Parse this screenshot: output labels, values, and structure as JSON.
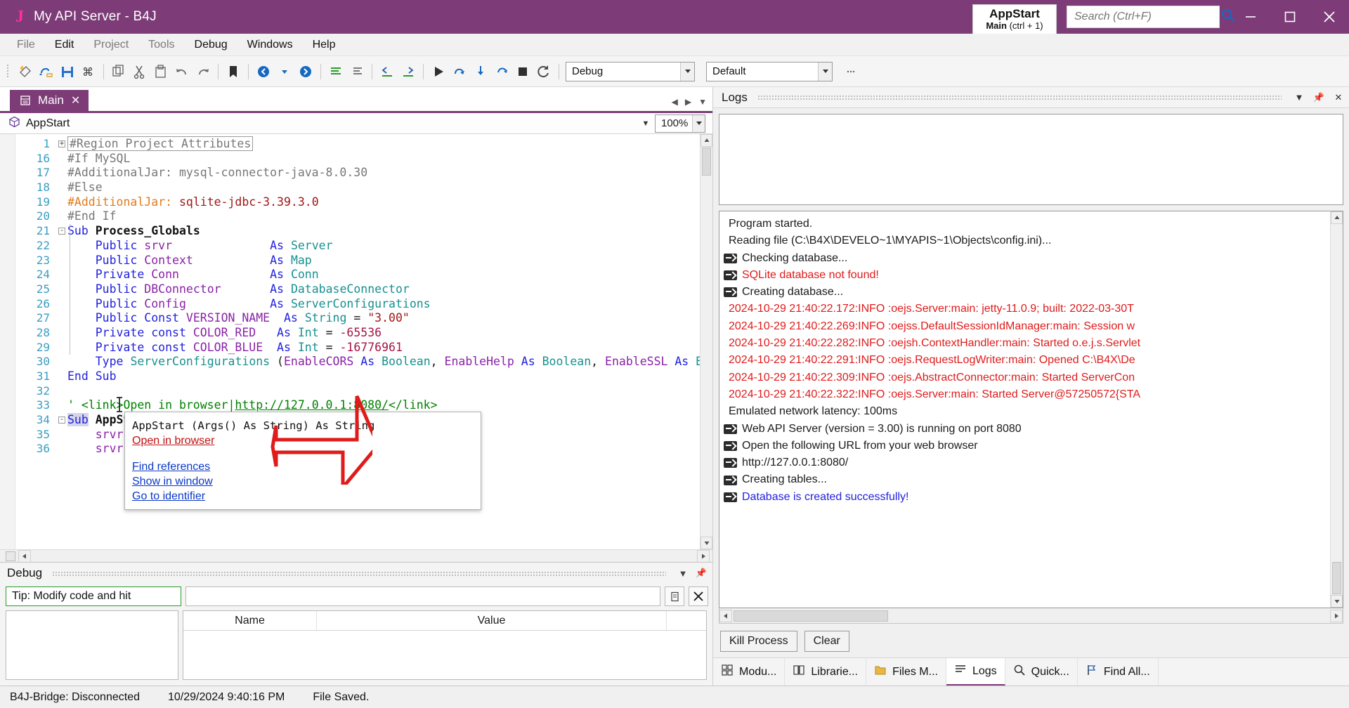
{
  "titlebar": {
    "logo": "J",
    "title": "My API Server - B4J",
    "appstart_chip": {
      "line1": "AppStart",
      "line2_bold": "Main",
      "line2_rest": "(ctrl + 1)"
    },
    "search_placeholder": "Search (Ctrl+F)",
    "window_buttons": [
      "minimize-button",
      "maximize-button",
      "close-button"
    ]
  },
  "menubar": {
    "items": [
      {
        "label": "File",
        "active": false
      },
      {
        "label": "Edit",
        "active": true
      },
      {
        "label": "Project",
        "active": false
      },
      {
        "label": "Tools",
        "active": false
      },
      {
        "label": "Debug",
        "active": true
      },
      {
        "label": "Windows",
        "active": true
      },
      {
        "label": "Help",
        "active": true
      }
    ]
  },
  "toolbar": {
    "configuration_value": "Debug",
    "build_value": "Default"
  },
  "editor": {
    "tab_label": "Main",
    "tab_close": "✕",
    "breadcrumb": "AppStart",
    "zoom_level": "100%",
    "lines": [
      {
        "num": "1",
        "fold": "+",
        "html": "<span class=\"regionbox\">#Region Project Attributes</span>"
      },
      {
        "num": "16",
        "fold": "",
        "html": "<span class=\"g\">#If MySQL</span>"
      },
      {
        "num": "17",
        "fold": "",
        "html": "<span class=\"g\">#AdditionalJar: mysql-connector-java-8.0.30</span>"
      },
      {
        "num": "18",
        "fold": "",
        "html": "<span class=\"g\">#Else</span>"
      },
      {
        "num": "19",
        "fold": "",
        "html": "<span class=\"o\">#AdditionalJar:</span> <span class=\"s\">sqlite-jdbc-3.39.3.0</span>"
      },
      {
        "num": "20",
        "fold": "",
        "html": "<span class=\"g\">#End If</span>"
      },
      {
        "num": "21",
        "fold": "-",
        "html": "<span class=\"k\">Sub</span> <span class=\"kb\">Process_Globals</span>"
      },
      {
        "num": "22",
        "fold": "",
        "html": "    <span class=\"k\">Public</span> <span class=\"v\">srvr</span>              <span class=\"k\">As</span> <span class=\"t\">Server</span>"
      },
      {
        "num": "23",
        "fold": "",
        "html": "    <span class=\"k\">Public</span> <span class=\"v\">Context</span>           <span class=\"k\">As</span> <span class=\"t\">Map</span>"
      },
      {
        "num": "24",
        "fold": "",
        "html": "    <span class=\"k\">Private</span> <span class=\"v\">Conn</span>             <span class=\"k\">As</span> <span class=\"t\">Conn</span>"
      },
      {
        "num": "25",
        "fold": "",
        "html": "    <span class=\"k\">Public</span> <span class=\"v\">DBConnector</span>       <span class=\"k\">As</span> <span class=\"t\">DatabaseConnector</span>"
      },
      {
        "num": "26",
        "fold": "",
        "html": "    <span class=\"k\">Public</span> <span class=\"v\">Config</span>            <span class=\"k\">As</span> <span class=\"t\">ServerConfigurations</span>"
      },
      {
        "num": "27",
        "fold": "",
        "html": "    <span class=\"k\">Public Const</span> <span class=\"v\">VERSION_NAME</span>  <span class=\"k\">As</span> <span class=\"t\">String</span> = <span class=\"s\">\"3.00\"</span>"
      },
      {
        "num": "28",
        "fold": "",
        "html": "    <span class=\"k\">Private const</span> <span class=\"v\">COLOR_RED</span>   <span class=\"k\">As</span> <span class=\"t\">Int</span> = <span class=\"n\">-65536</span>"
      },
      {
        "num": "29",
        "fold": "",
        "html": "    <span class=\"k\">Private const</span> <span class=\"v\">COLOR_BLUE</span>  <span class=\"k\">As</span> <span class=\"t\">Int</span> = <span class=\"n\">-16776961</span>"
      },
      {
        "num": "30",
        "fold": "",
        "html": "    <span class=\"k\">Type</span> <span class=\"t\">ServerConfigurations</span> (<span class=\"v\">EnableCORS</span> <span class=\"k\">As</span> <span class=\"t\">Boolean</span>, <span class=\"v\">EnableHelp</span> <span class=\"k\">As</span> <span class=\"t\">Boolean</span>, <span class=\"v\">EnableSSL</span> <span class=\"k\">As</span> <span class=\"t\">Boolean</span>, <span class=\"v\">Port</span> <span class=\"k\">As</span>"
      },
      {
        "num": "31",
        "fold": "",
        "html": "<span class=\"k\">End Sub</span>"
      },
      {
        "num": "32",
        "fold": "",
        "html": ""
      },
      {
        "num": "33",
        "fold": "",
        "html": "<span class=\"c\">' &lt;link&gt;Open in browser|</span><span class=\"lnk\">http://127.0.0.1:8080/</span><span class=\"c\">&lt;/link&gt;</span>"
      },
      {
        "num": "34",
        "fold": "-",
        "html": "<span class=\"k selword\">Sub</span> <span class=\"kb\">AppStart</span> (<span class=\"v\">Args</span>() <span class=\"k\">As</span> <span class=\"t\">String</span>)"
      },
      {
        "num": "35",
        "fold": "",
        "html": "    <span class=\"v\">srvr</span>"
      },
      {
        "num": "36",
        "fold": "",
        "html": "    <span class=\"v\">srvr</span>"
      }
    ]
  },
  "popup": {
    "signature_plain": "AppStart (Args() As String) As String",
    "open_in_browser": "Open in browser",
    "links": [
      "Find references",
      "Show in window",
      "Go to identifier"
    ]
  },
  "debug_panel": {
    "title": "Debug",
    "tip_text": "Tip: Modify code and hit",
    "columns": [
      "Name",
      "Value"
    ]
  },
  "logs_panel": {
    "title": "Logs",
    "lines": [
      {
        "icon": false,
        "color": "dark",
        "text": "Program started."
      },
      {
        "icon": false,
        "color": "dark",
        "text": "Reading file (C:\\B4X\\DEVELO~1\\MYAPIS~1\\Objects\\config.ini)..."
      },
      {
        "icon": true,
        "color": "dark",
        "text": "Checking database..."
      },
      {
        "icon": true,
        "color": "red",
        "text": "SQLite database not found!"
      },
      {
        "icon": true,
        "color": "dark",
        "text": "Creating database..."
      },
      {
        "icon": false,
        "color": "red",
        "text": "2024-10-29 21:40:22.172:INFO :oejs.Server:main: jetty-11.0.9; built: 2022-03-30T"
      },
      {
        "icon": false,
        "color": "red",
        "text": "2024-10-29 21:40:22.269:INFO :oejss.DefaultSessionIdManager:main: Session w"
      },
      {
        "icon": false,
        "color": "red",
        "text": "2024-10-29 21:40:22.282:INFO :oejsh.ContextHandler:main: Started o.e.j.s.Servlet"
      },
      {
        "icon": false,
        "color": "red",
        "text": "2024-10-29 21:40:22.291:INFO :oejs.RequestLogWriter:main: Opened C:\\B4X\\De"
      },
      {
        "icon": false,
        "color": "red",
        "text": "2024-10-29 21:40:22.309:INFO :oejs.AbstractConnector:main: Started ServerCon"
      },
      {
        "icon": false,
        "color": "red",
        "text": "2024-10-29 21:40:22.322:INFO :oejs.Server:main: Started Server@57250572{STA"
      },
      {
        "icon": false,
        "color": "dark",
        "text": "Emulated network latency: 100ms"
      },
      {
        "icon": true,
        "color": "dark",
        "text": "Web API Server (version = 3.00) is running on port 8080"
      },
      {
        "icon": true,
        "color": "dark",
        "text": "Open the following URL from your web browser"
      },
      {
        "icon": true,
        "color": "dark",
        "text": "http://127.0.0.1:8080/"
      },
      {
        "icon": true,
        "color": "dark",
        "text": "Creating tables..."
      },
      {
        "icon": true,
        "color": "blue",
        "text": "Database is created successfully!"
      }
    ],
    "kill_process_label": "Kill Process",
    "clear_label": "Clear"
  },
  "bottom_tabs": [
    {
      "label": "Modu...",
      "icon": "modules-icon",
      "active": false
    },
    {
      "label": "Librarie...",
      "icon": "libraries-icon",
      "active": false
    },
    {
      "label": "Files M...",
      "icon": "files-icon",
      "active": false
    },
    {
      "label": "Logs",
      "icon": "logs-icon",
      "active": true
    },
    {
      "label": "Quick...",
      "icon": "search-icon",
      "active": false
    },
    {
      "label": "Find All...",
      "icon": "flag-icon",
      "active": false
    }
  ],
  "statusbar": {
    "bridge": "B4J-Bridge: Disconnected",
    "timestamp": "10/29/2024 9:40:16 PM",
    "message": "File Saved."
  },
  "colors": {
    "brand_purple": "#7d3c78",
    "logo_pink": "#ff2fa0",
    "annotation_red": "#e01b1b",
    "log_error_red": "#e01b1b",
    "log_success_blue": "#2222dd"
  }
}
